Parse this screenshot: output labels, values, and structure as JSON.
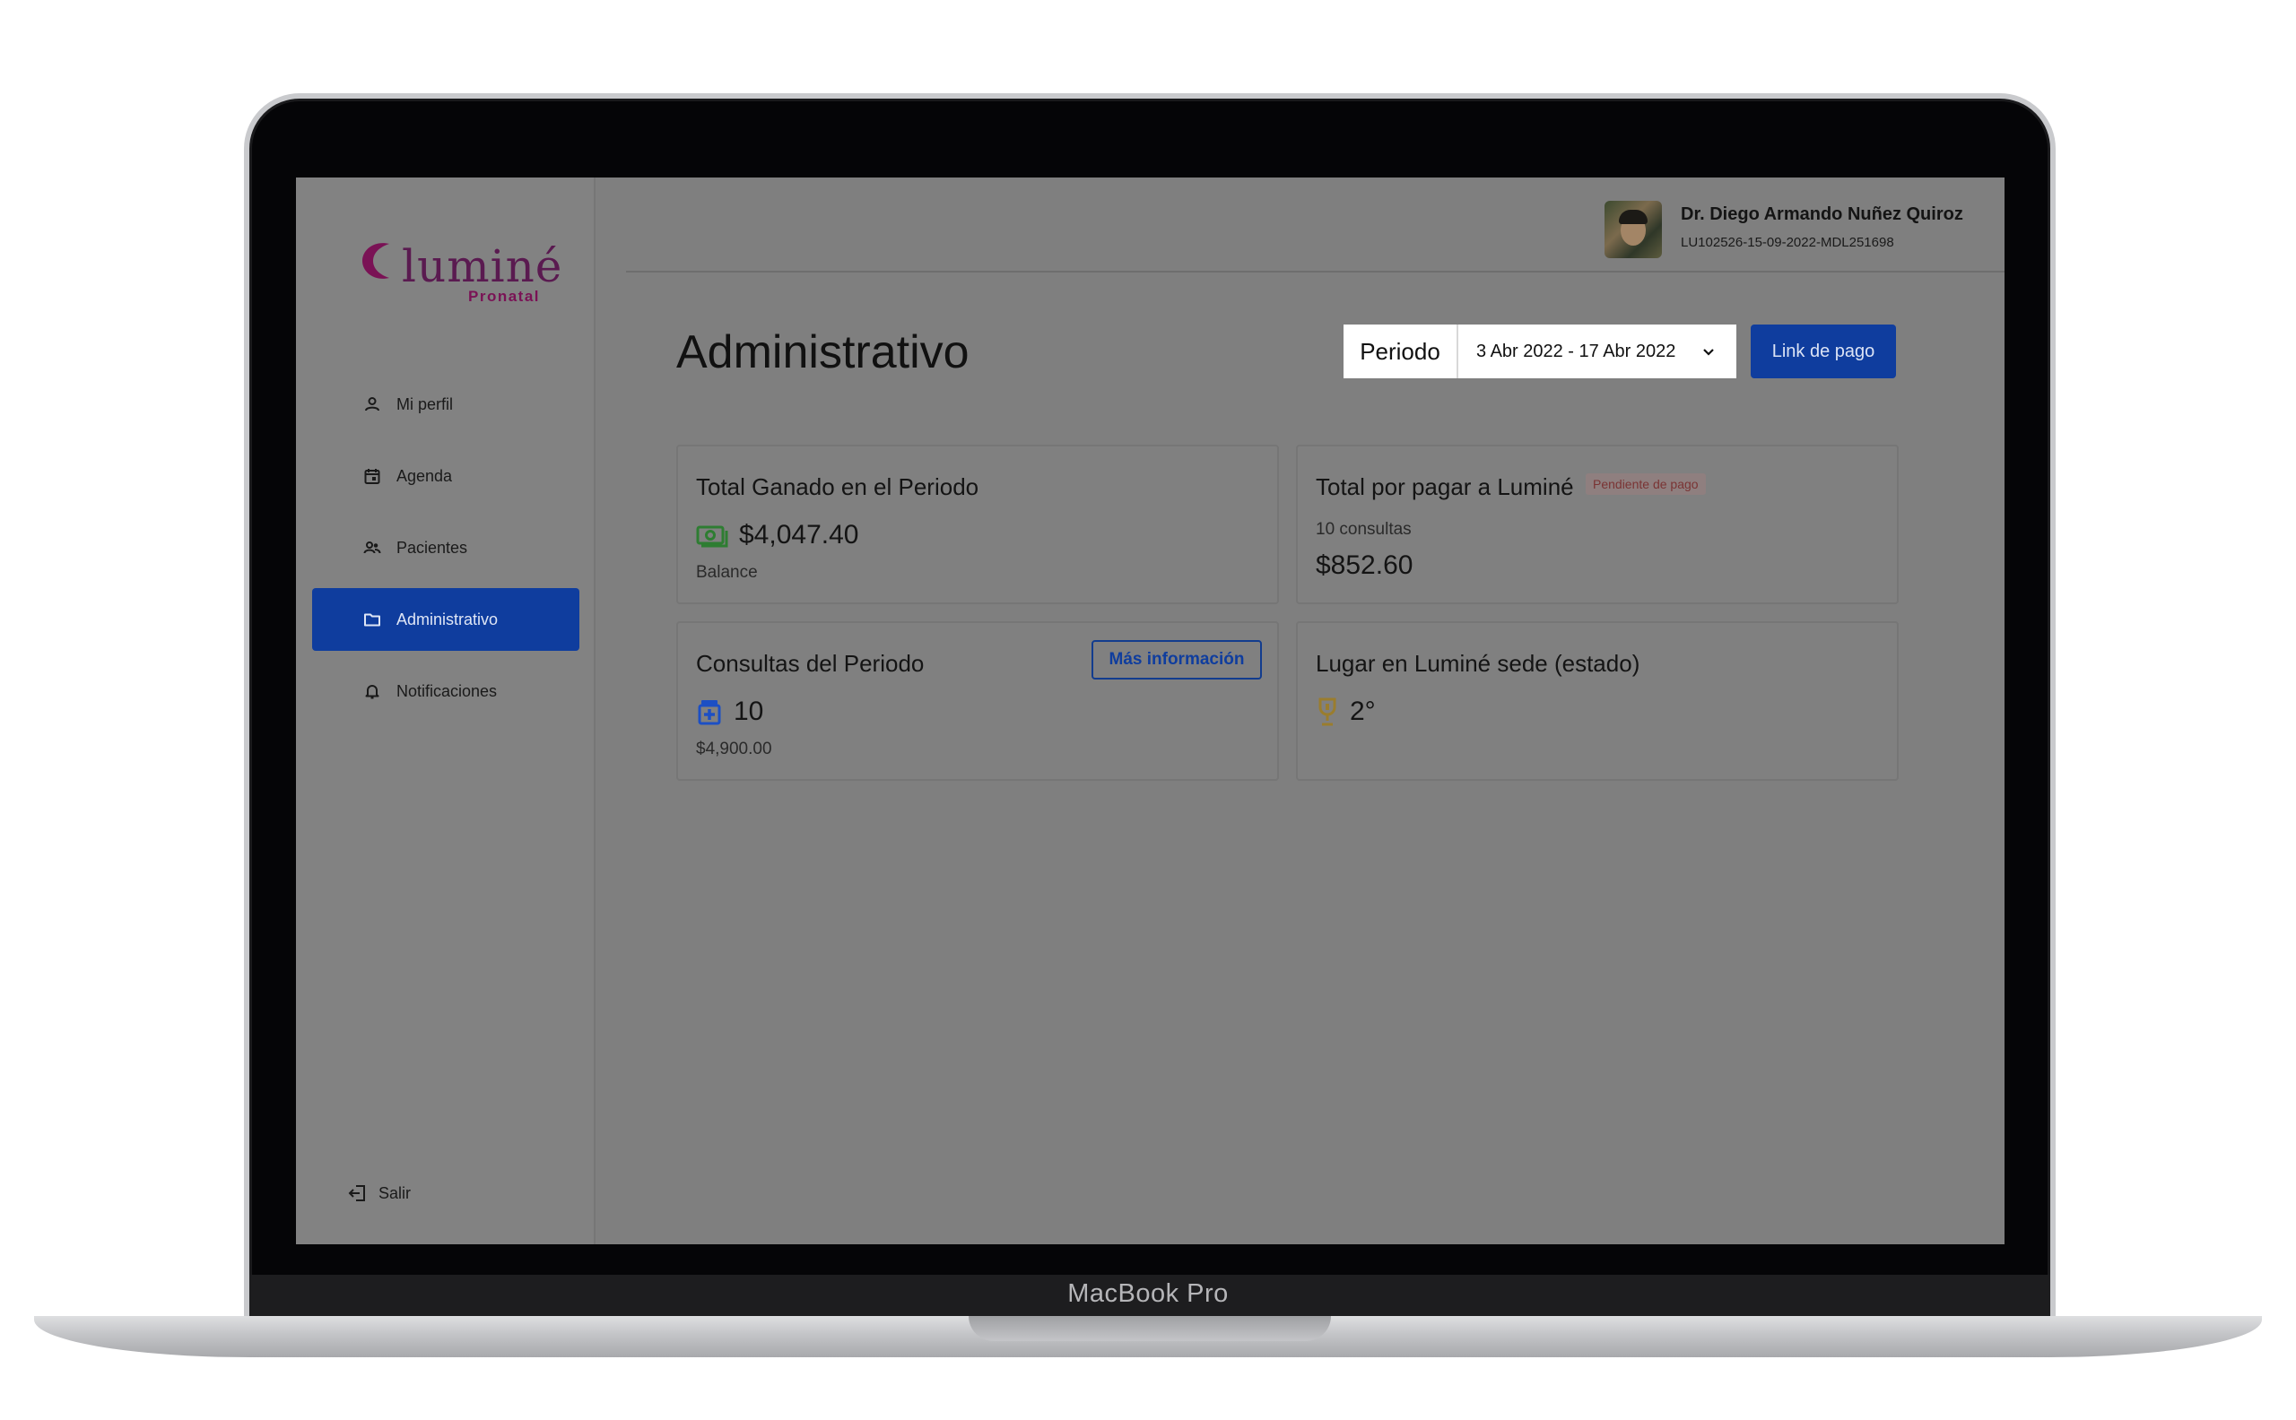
{
  "device": {
    "model_label": "MacBook Pro"
  },
  "brand": {
    "name": "luminé",
    "tagline": "Pronatal"
  },
  "sidebar": {
    "items": [
      {
        "label": "Mi perfil",
        "icon": "user-icon",
        "active": false
      },
      {
        "label": "Agenda",
        "icon": "calendar-icon",
        "active": false
      },
      {
        "label": "Pacientes",
        "icon": "users-icon",
        "active": false
      },
      {
        "label": "Administrativo",
        "icon": "folder-icon",
        "active": true
      },
      {
        "label": "Notificaciones",
        "icon": "bell-icon",
        "active": false
      }
    ],
    "logout_label": "Salir"
  },
  "header": {
    "user_name": "Dr. Diego Armando Nuñez Quiroz",
    "user_id": "LU102526-15-09-2022-MDL251698"
  },
  "page": {
    "title": "Administrativo",
    "period_label": "Periodo",
    "period_value": "3 Abr 2022 - 17 Abr 2022",
    "pay_link_label": "Link de pago"
  },
  "cards": {
    "earned": {
      "title": "Total Ganado en el Periodo",
      "value": "$4,047.40",
      "sub": "Balance"
    },
    "to_pay": {
      "title": "Total por pagar a Luminé",
      "badge": "Pendiente de pago",
      "count": "10 consultas",
      "value": "$852.60"
    },
    "consults": {
      "title": "Consultas del Periodo",
      "button": "Más información",
      "value": "10",
      "sub": "$4,900.00"
    },
    "ranking": {
      "title": "Lugar en Luminé sede (estado)",
      "value": "2°"
    }
  },
  "colors": {
    "accent": "#0f3d9e",
    "brand": "#7a1255",
    "money_icon": "#2e7d32",
    "trophy_icon": "#9a7d2e"
  }
}
